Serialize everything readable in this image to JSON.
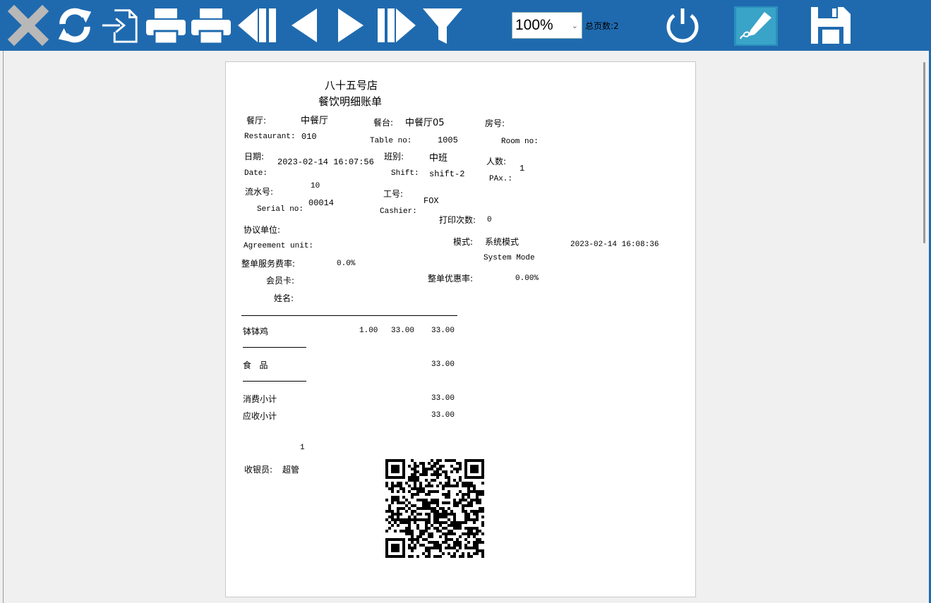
{
  "toolbar": {
    "zoom": "100%",
    "page_total": "总页数:2",
    "icons": [
      "close-icon",
      "refresh-icon",
      "export-icon",
      "print-icon",
      "printer-icon",
      "first-page-icon",
      "previous-page-icon",
      "next-page-icon",
      "last-page-icon",
      "filter-icon",
      "power-icon",
      "signature-icon",
      "save-icon"
    ]
  },
  "receipt": {
    "shop_name": "八十五号店",
    "title": "餐饮明细账单",
    "restaurant_cn": "餐厅:",
    "restaurant_val": "中餐厅",
    "restaurant_en": "Restaurant:",
    "restaurant_code": "010",
    "table_cn": "餐台:",
    "table_val": "中餐厅05",
    "table_en": "Table no:",
    "table_no": "1005",
    "room_cn": "房号:",
    "room_en": "Room no:",
    "date_cn": "日期:",
    "date_val": "2023-02-14 16:07:56",
    "date_en": "Date:",
    "shift_cn": "班别:",
    "shift_val": "中班",
    "shift_en": "Shift:",
    "shift_code": "shift-2",
    "pax_cn": "人数:",
    "pax_val": "1",
    "pax_en": "PAx.:",
    "serial_cn": "流水号:",
    "serial_top": "10",
    "serial_en": "Serial no:",
    "serial_val": "00014",
    "cashier_id_cn": "工号:",
    "cashier_id_val": "FOX",
    "cashier_en": "Cashier:",
    "print_count_cn": "打印次数:",
    "print_count_val": "0",
    "agreement_cn": "协议单位:",
    "agreement_en": "Agreement unit:",
    "mode_cn": "模式:",
    "mode_val": "系统模式",
    "mode_en": "System Mode",
    "mode_time": "2023-02-14 16:08:36",
    "service_rate_cn": "整单服务费率:",
    "service_rate_val": "0.0%",
    "member_card_cn": "会员卡:",
    "discount_cn": "整单优惠率:",
    "discount_val": "0.00%",
    "name_cn": "姓名:",
    "item_name": "钵钵鸡",
    "item_qty": "1.00",
    "item_price": "33.00",
    "item_amount": "33.00",
    "category": "食   品",
    "category_amount": "33.00",
    "subtotal_cn": "消费小计",
    "subtotal_val": "33.00",
    "receivable_cn": "应收小计",
    "receivable_val": "33.00",
    "page_num": "1",
    "cashier_cn": "收银员:",
    "cashier_val": "超管"
  }
}
